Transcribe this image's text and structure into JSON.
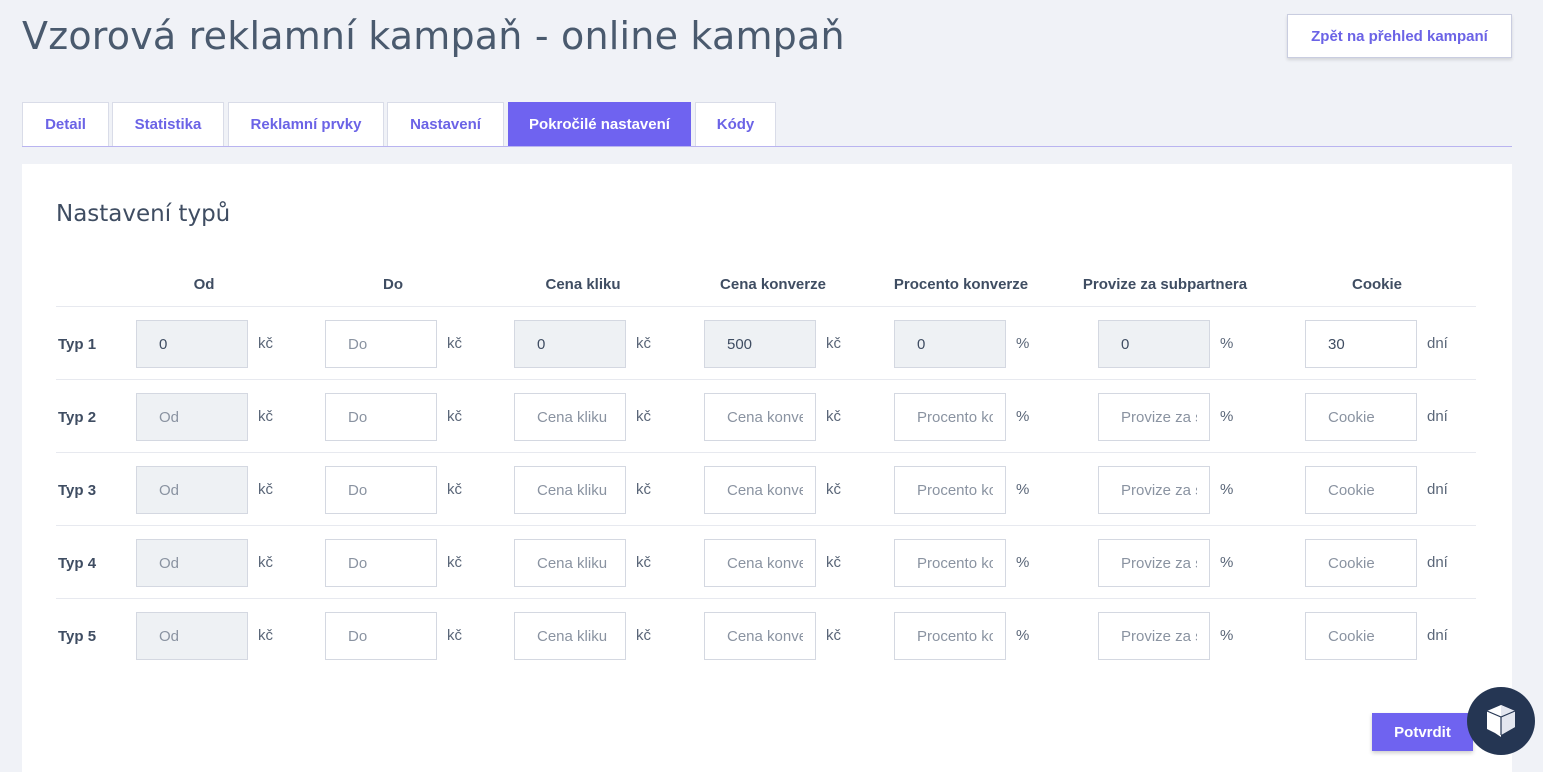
{
  "header": {
    "title": "Vzorová reklamní kampaň - online kampaň",
    "back_label": "Zpět na přehled kampaní"
  },
  "tabs": [
    {
      "label": "Detail",
      "active": false
    },
    {
      "label": "Statistika",
      "active": false
    },
    {
      "label": "Reklamní prvky",
      "active": false
    },
    {
      "label": "Nastavení",
      "active": false
    },
    {
      "label": "Pokročilé nastavení",
      "active": true
    },
    {
      "label": "Kódy",
      "active": false
    }
  ],
  "section": {
    "title": "Nastavení typů",
    "columns": [
      "Od",
      "Do",
      "Cena kliku",
      "Cena konverze",
      "Procento konverze",
      "Provize za subpartnera",
      "Cookie"
    ],
    "units": [
      "kč",
      "kč",
      "kč",
      "kč",
      "%",
      "%",
      "dní"
    ],
    "placeholders": [
      "Od",
      "Do",
      "Cena kliku",
      "Cena konverze",
      "Procento konverze",
      "Provize za subpartnera",
      "Cookie"
    ],
    "disabled_columns": [
      true,
      false,
      false,
      false,
      false,
      false,
      false
    ],
    "rows": [
      {
        "label": "Typ 1",
        "values": [
          "0",
          "",
          "0",
          "500",
          "0",
          "0",
          "30"
        ],
        "disabled": [
          true,
          false,
          true,
          true,
          true,
          true,
          false
        ]
      },
      {
        "label": "Typ 2",
        "values": [
          "",
          "",
          "",
          "",
          "",
          "",
          ""
        ],
        "disabled": [
          true,
          false,
          false,
          false,
          false,
          false,
          false
        ]
      },
      {
        "label": "Typ 3",
        "values": [
          "",
          "",
          "",
          "",
          "",
          "",
          ""
        ],
        "disabled": [
          true,
          false,
          false,
          false,
          false,
          false,
          false
        ]
      },
      {
        "label": "Typ 4",
        "values": [
          "",
          "",
          "",
          "",
          "",
          "",
          ""
        ],
        "disabled": [
          true,
          false,
          false,
          false,
          false,
          false,
          false
        ]
      },
      {
        "label": "Typ 5",
        "values": [
          "",
          "",
          "",
          "",
          "",
          "",
          ""
        ],
        "disabled": [
          true,
          false,
          false,
          false,
          false,
          false,
          false
        ]
      }
    ],
    "confirm_label": "Potvrdit"
  },
  "colors": {
    "accent": "#6f63f0",
    "chat_bubble": "#253653",
    "background": "#f0f2f7"
  },
  "icons": {
    "chat": "chat-icon"
  }
}
